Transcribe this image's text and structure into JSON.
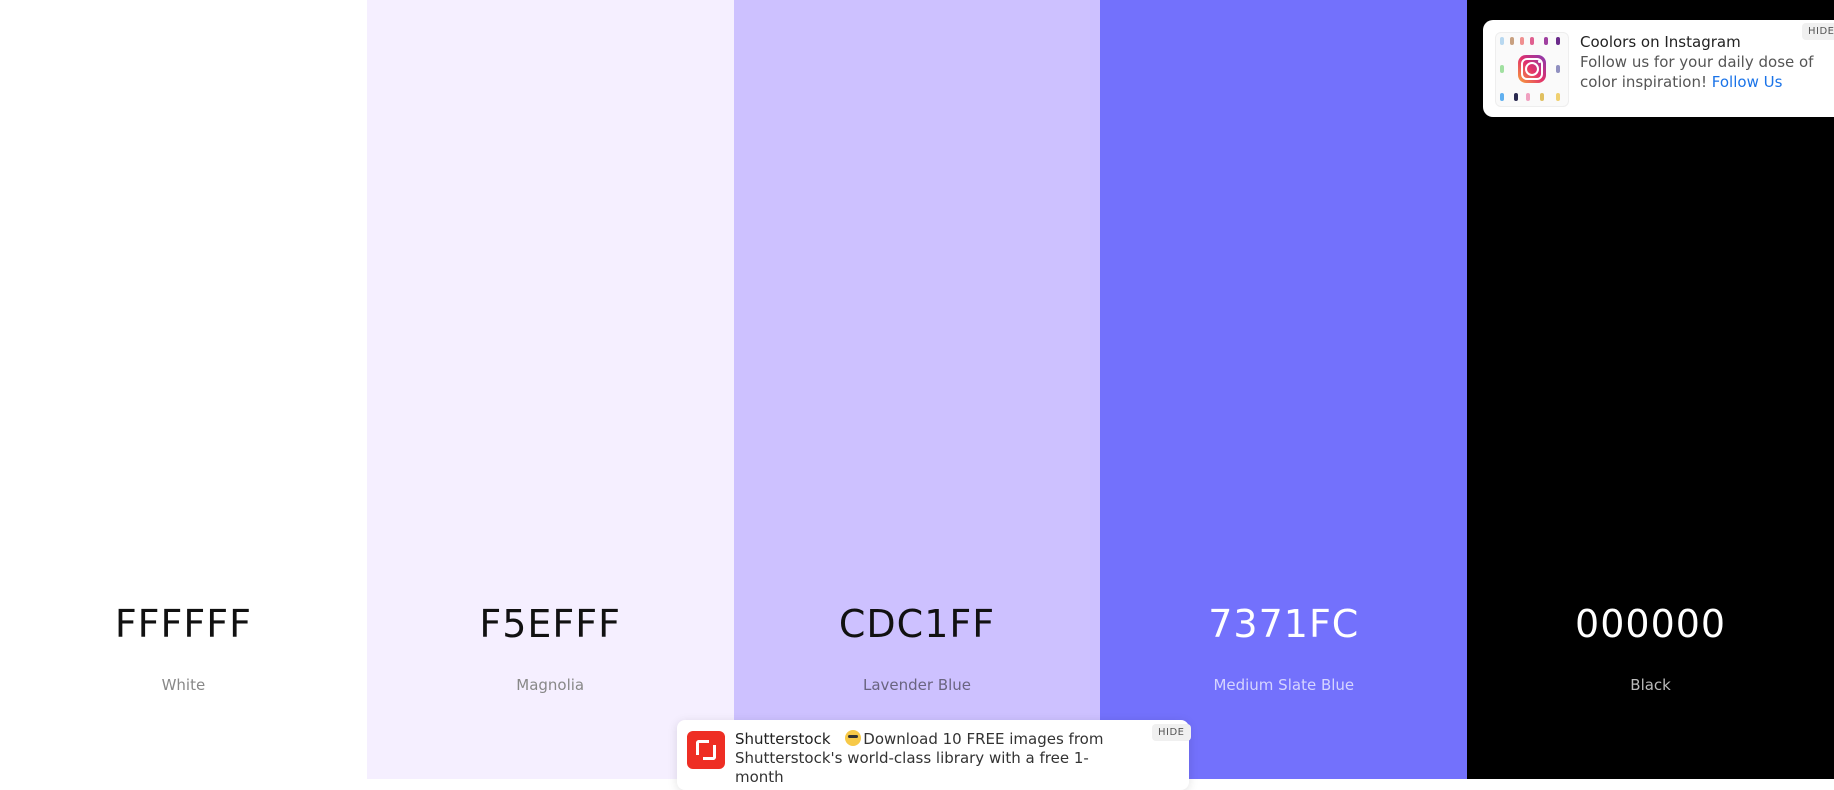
{
  "palette": [
    {
      "hex": "FFFFFF",
      "name": "White",
      "bg": "#FFFFFF",
      "hex_color": "#111111",
      "name_color": "#888888"
    },
    {
      "hex": "F5EFFF",
      "name": "Magnolia",
      "bg": "#F5EFFF",
      "hex_color": "#111111",
      "name_color": "#888888"
    },
    {
      "hex": "CDC1FF",
      "name": "Lavender Blue",
      "bg": "#CDC1FF",
      "hex_color": "#111111",
      "name_color": "#6a6480"
    },
    {
      "hex": "7371FC",
      "name": "Medium Slate Blue",
      "bg": "#7371FC",
      "hex_color": "#FFFFFF",
      "name_color": "#D6D5FF"
    },
    {
      "hex": "000000",
      "name": "Black",
      "bg": "#000000",
      "hex_color": "#FFFFFF",
      "name_color": "#BBBBBB"
    }
  ],
  "instagram_popup": {
    "title": "Coolors on Instagram",
    "body": "Follow us for your daily dose of color inspiration!",
    "link": "Follow Us",
    "hide": "HIDE",
    "logo_icon": "instagram-icon"
  },
  "shutterstock_popup": {
    "brand": "Shutterstock",
    "message": "Download 10 FREE images from Shutterstock's world-class library with a free 1-month",
    "hide": "HIDE",
    "logo_icon": "shutterstock-logo-icon",
    "emoji_icon": "cool-emoji-icon"
  }
}
